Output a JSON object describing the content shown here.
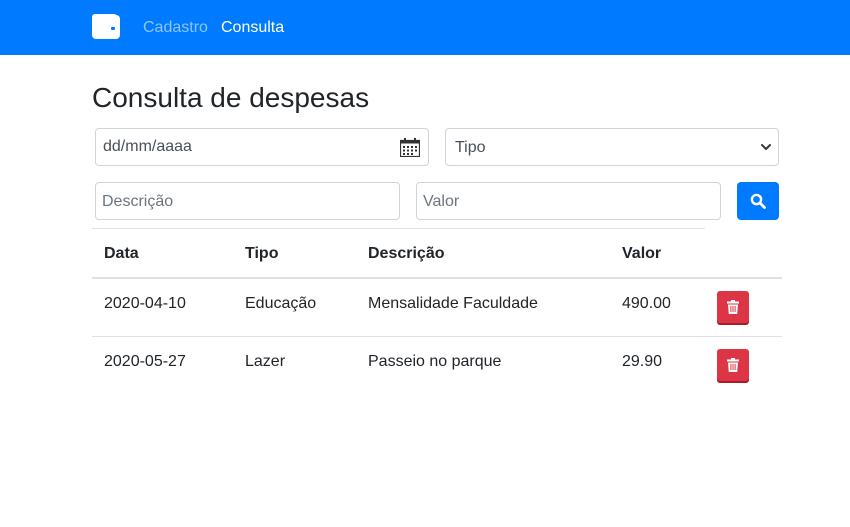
{
  "navbar": {
    "brand_icon": "wallet-icon",
    "links": [
      {
        "label": "Cadastro",
        "active": false
      },
      {
        "label": "Consulta",
        "active": true
      }
    ],
    "background": "#007bff"
  },
  "page": {
    "title": "Consulta de despesas"
  },
  "filters": {
    "date": {
      "value": "dd/mm/aaaa",
      "icon": "calendar-icon"
    },
    "tipo": {
      "selected": "Tipo",
      "icon": "chevron-down-icon"
    },
    "descricao": {
      "placeholder": "Descrição"
    },
    "valor": {
      "placeholder": "Valor"
    },
    "search_button": {
      "icon": "search-icon",
      "color": "#007bff"
    }
  },
  "table": {
    "headers": [
      "Data",
      "Tipo",
      "Descrição",
      "Valor"
    ],
    "rows": [
      {
        "data": "2020-04-10",
        "tipo": "Educação",
        "descricao": "Mensalidade Faculdade",
        "valor": "490.00"
      },
      {
        "data": "2020-05-27",
        "tipo": "Lazer",
        "descricao": "Passeio no parque",
        "valor": "29.90"
      }
    ],
    "delete_button": {
      "icon": "trash-icon",
      "color": "#dc3545"
    }
  }
}
